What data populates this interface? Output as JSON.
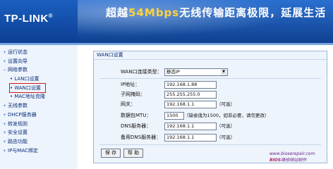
{
  "header": {
    "logo": "TP-LINK",
    "logo_mark": "®",
    "slogan_pre": "超越",
    "slogan_hl": "54Mbps",
    "slogan_post": "无线传输距离极限，延展生活"
  },
  "sidebar": {
    "items": [
      {
        "label": "运行状态"
      },
      {
        "label": "设置向导"
      },
      {
        "label": "网络参数"
      },
      {
        "label": "• LAN口设置"
      },
      {
        "label": "• WAN口设置"
      },
      {
        "label": "• MAC地址克隆"
      },
      {
        "label": "无线参数"
      },
      {
        "label": "DHCP服务器"
      },
      {
        "label": "转发规则"
      },
      {
        "label": "安全设置"
      },
      {
        "label": "路由功能"
      },
      {
        "label": "IP与MAC绑定"
      }
    ]
  },
  "panel": {
    "title": "WAN口设置",
    "wan_type_label": "WAN口连接类型：",
    "wan_type_value": "静态IP",
    "ip_label": "IP地址：",
    "ip_value": "192.168.1.88",
    "mask_label": "子网掩码：",
    "mask_value": "255.255.255.0",
    "gateway_label": "网关：",
    "gateway_value": "192.168.1.1",
    "gateway_note": "（可选）",
    "mtu_label": "数据包MTU：",
    "mtu_value": "1500",
    "mtu_note": "（缺省值为1500，如非必要，请勿更改）",
    "dns_label": "DNS服务器：",
    "dns_value": "192.168.1.1",
    "dns_note": "（可选）",
    "dns2_label": "备用DNS服务器：",
    "dns2_value": "192.168.1.1",
    "dns2_note": "（可选）",
    "save_label": "保 存",
    "help_label": "帮 助"
  },
  "watermark": {
    "site": "www.bioserepair.com",
    "brand": "BIOS",
    "suffix": "维修网站制作"
  }
}
